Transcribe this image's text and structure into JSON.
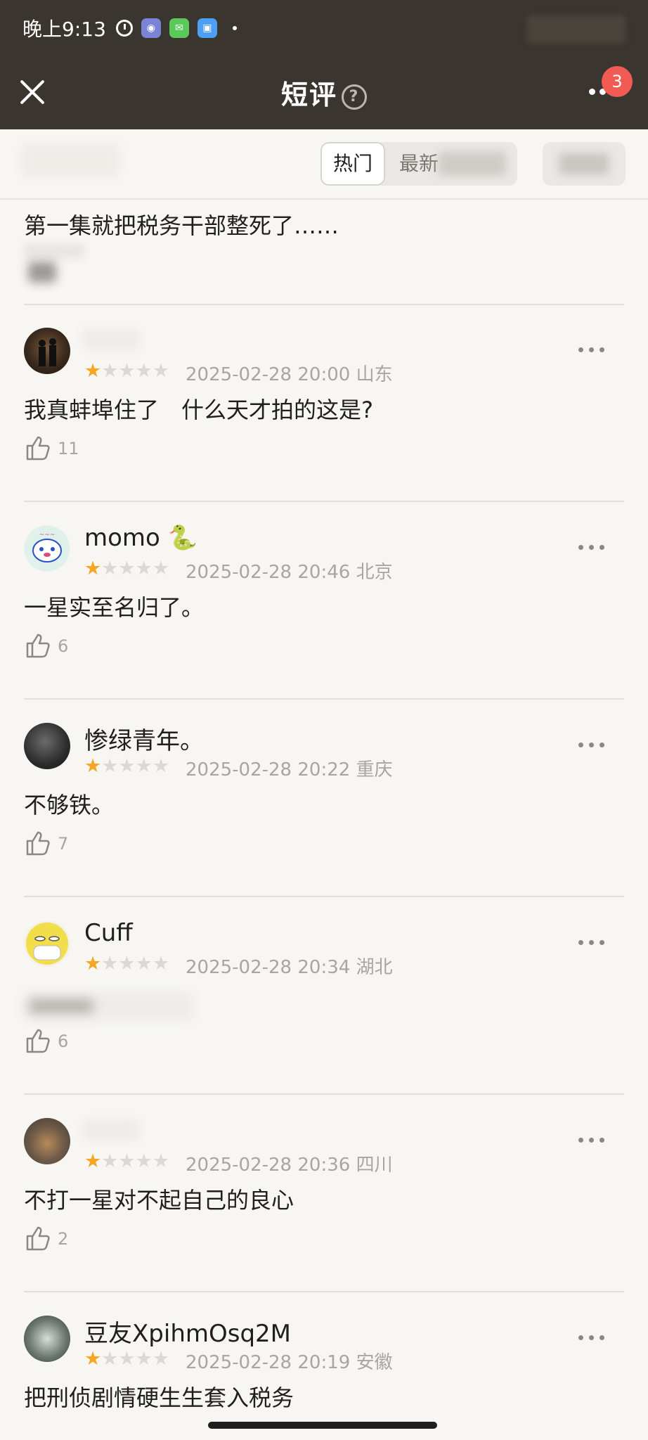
{
  "status_bar": {
    "time": "晚上9:13",
    "apps": [
      {
        "icon": "app-icon-blue",
        "color": "#7a84d6"
      },
      {
        "icon": "wechat-icon",
        "color": "#5ac95a"
      },
      {
        "icon": "bag-icon",
        "color": "#4d9ef5"
      }
    ]
  },
  "nav": {
    "title": "短评",
    "help": "?",
    "notification_count": "3"
  },
  "filter": {
    "tab_hot": "热门",
    "tab_new": "最新"
  },
  "partial_review": {
    "text": "第一集就把税务干部整死了……"
  },
  "reviews": [
    {
      "username": "",
      "stars": 1,
      "date": "2025-02-28 20:00",
      "location": "山东",
      "text": "我真蚌埠住了　什么天才拍的这是?",
      "likes": "11"
    },
    {
      "username": "momo 🐍",
      "stars": 1,
      "date": "2025-02-28 20:46",
      "location": "北京",
      "text": "一星实至名归了。",
      "likes": "6"
    },
    {
      "username": " 惨绿青年。",
      "stars": 1,
      "date": "2025-02-28 20:22",
      "location": "重庆",
      "text": "不够铁。",
      "likes": "7"
    },
    {
      "username": "Cuff",
      "stars": 1,
      "date": "2025-02-28 20:34",
      "location": "湖北",
      "text": "",
      "likes": "6"
    },
    {
      "username": "",
      "stars": 1,
      "date": "2025-02-28 20:36",
      "location": "四川",
      "text": "不打一星对不起自己的良心",
      "likes": "2"
    },
    {
      "username": "豆友XpihmOsq2M",
      "stars": 1,
      "date": "2025-02-28 20:19",
      "location": "安徽",
      "text": "把刑侦剧情硬生生套入税务",
      "likes": ""
    }
  ],
  "colors": {
    "topbar": "#3b352f",
    "star_on": "#f5a623",
    "badge": "#f25b53",
    "background": "#f7f6f3"
  }
}
